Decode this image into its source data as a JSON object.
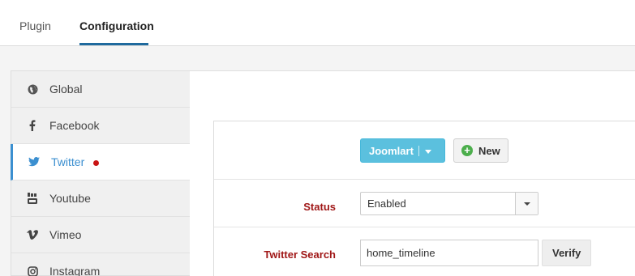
{
  "tabs": [
    {
      "label": "Plugin",
      "active": false
    },
    {
      "label": "Configuration",
      "active": true
    }
  ],
  "sidebar": {
    "items": [
      {
        "label": "Global",
        "icon": "globe-icon",
        "active": false
      },
      {
        "label": "Facebook",
        "icon": "facebook-icon",
        "active": false
      },
      {
        "label": "Twitter",
        "icon": "twitter-icon",
        "active": true,
        "indicator_color": "#c91414"
      },
      {
        "label": "Youtube",
        "icon": "youtube-icon",
        "active": false
      },
      {
        "label": "Vimeo",
        "icon": "vimeo-icon",
        "active": false
      },
      {
        "label": "Instagram",
        "icon": "instagram-icon",
        "active": false
      }
    ]
  },
  "form": {
    "account_button": "Joomlart",
    "new_button": "New",
    "status": {
      "label": "Status",
      "value": "Enabled"
    },
    "twitter_search": {
      "label": "Twitter Search",
      "value": "home_timeline",
      "verify_label": "Verify"
    }
  },
  "colors": {
    "accent": "#3b8fd0",
    "account_button": "#5bc0de",
    "label_red": "#a01717",
    "new_plus_green": "#4cae4c"
  }
}
